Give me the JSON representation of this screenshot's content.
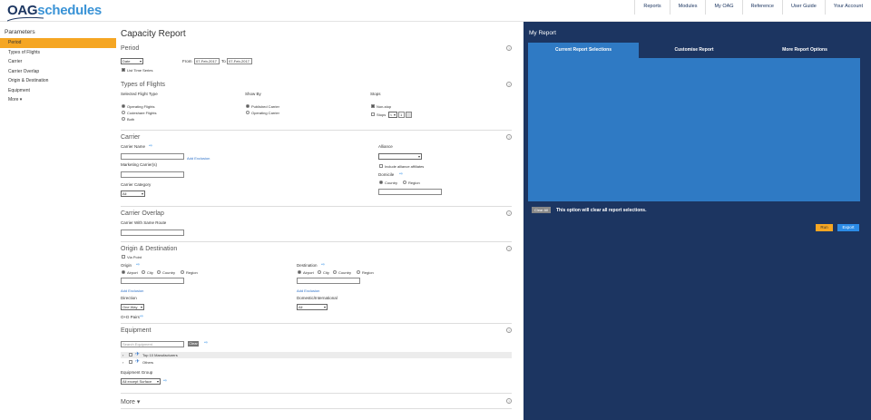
{
  "logo": {
    "oag": "OAG",
    "schedules": "schedules"
  },
  "nav": [
    "Reports",
    "Modules",
    "My OAG",
    "Reference",
    "User Guide",
    "Your Account"
  ],
  "sidebar": {
    "title": "Parameters",
    "items": [
      "Period",
      "Types of Flights",
      "Carrier",
      "Carrier Overlap",
      "Origin & Destination",
      "Equipment",
      "More"
    ],
    "active_index": 0
  },
  "page_title": "Capacity Report",
  "period": {
    "title": "Period",
    "type_select": "Date",
    "from_label": "From",
    "from_value": "07-Feb-2017",
    "to_label": "To",
    "to_value": "07-Feb-2017",
    "list_time_series": "List Time Series"
  },
  "types_of_flights": {
    "title": "Types of Flights",
    "col1_label": "Selected Flight Type",
    "col1_options": [
      "Operating Flights",
      "Codeshare Flights",
      "Both"
    ],
    "col2_label": "Show By",
    "col2_options": [
      "Published Carrier",
      "Operating Carrier"
    ],
    "col3_label": "Stops",
    "nonstop": "Non-stop",
    "stops_label": "Stops",
    "stops_op": "<",
    "stops_value": "1"
  },
  "carrier": {
    "title": "Carrier",
    "carrier_name_label": "Carrier Name",
    "add_exclusion": "Add Exclusion",
    "marketing_label": "Marketing Carrier(s)",
    "category_label": "Carrier Category",
    "category_value": "All",
    "alliance_label": "Alliance",
    "include_affiliates": "Include alliance affiliates",
    "domicile_label": "Domicile",
    "domicile_options": [
      "Country",
      "Region"
    ]
  },
  "carrier_overlap": {
    "title": "Carrier Overlap",
    "same_route_label": "Carrier With Same Route"
  },
  "origin_destination": {
    "title": "Origin & Destination",
    "via_point": "Via Point",
    "origin_label": "Origin",
    "destination_label": "Destination",
    "location_options": [
      "Airport",
      "City",
      "Country",
      "Region"
    ],
    "add_exclusion": "Add Exclusion",
    "direction_label": "Direction",
    "direction_value": "One Way",
    "domestic_label": "Domestic/International",
    "domestic_value": "All",
    "od_pairs": "O+D Pairs"
  },
  "equipment": {
    "title": "Equipment",
    "search_placeholder": "Search Equipment",
    "clear_btn": "Clear",
    "tree": [
      "Top 10 Manufacturers",
      "Others"
    ],
    "group_label": "Equipment Group",
    "group_value": "All except Surface"
  },
  "more": {
    "title": "More"
  },
  "my_report": {
    "title": "My Report",
    "tabs": [
      "Current Report Selections",
      "Customise Report",
      "More Report Options"
    ],
    "active_tab": 0,
    "clear_all": "Clear All",
    "clear_note": "This option will clear all report selections.",
    "run": "Run",
    "export": "Export"
  },
  "colors": {
    "accent": "#f5a623",
    "navy": "#1c3561",
    "blue_panel": "#2f7ac4",
    "button_blue": "#2b8be6"
  }
}
